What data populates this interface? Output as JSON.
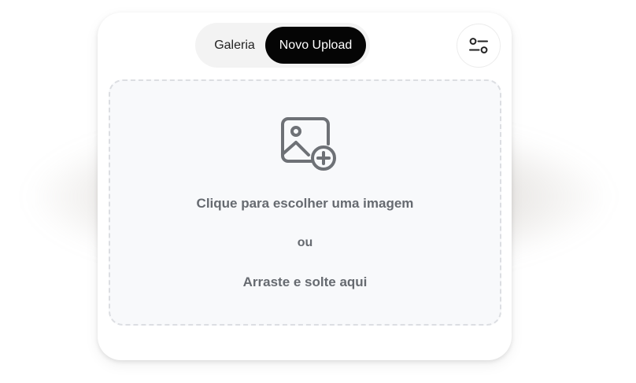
{
  "tabs": {
    "gallery_label": "Galeria",
    "upload_label": "Novo Upload",
    "active": "upload_label"
  },
  "settings": {
    "icon": "sliders-icon"
  },
  "dropzone": {
    "icon": "image-add-icon",
    "title": "Clique para escolher uma imagem",
    "or": "ou",
    "drag": "Arraste e solte aqui"
  },
  "colors": {
    "active_tab_bg": "#050505",
    "active_tab_text": "#ffffff",
    "segment_bg": "#f3f3f3",
    "dropzone_bg": "#f8f9fb",
    "dropzone_border": "#dcdee2",
    "text_muted": "#666a70"
  }
}
